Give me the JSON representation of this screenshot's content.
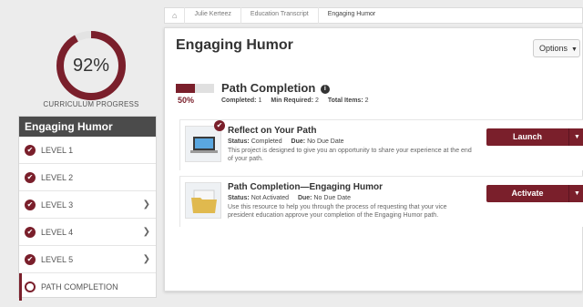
{
  "progress": {
    "percent_label": "92%",
    "percent_value": 92,
    "label": "CURRICULUM PROGRESS"
  },
  "colors": {
    "accent": "#7a1f2b",
    "header_bg": "#4b4b4b"
  },
  "sidebar": {
    "heading": "Engaging Humor",
    "items": [
      {
        "label": "LEVEL 1"
      },
      {
        "label": "LEVEL 2"
      },
      {
        "label": "LEVEL 3"
      },
      {
        "label": "LEVEL 4"
      },
      {
        "label": "LEVEL 5"
      },
      {
        "label": "PATH COMPLETION"
      }
    ]
  },
  "breadcrumb": {
    "home_icon": "home-icon",
    "items": [
      "Julie Kerteez",
      "Education Transcript",
      "Engaging Humor"
    ]
  },
  "main": {
    "title": "Engaging Humor",
    "options_label": "Options",
    "path_completion": {
      "title": "Path Completion",
      "percent_label": "50%",
      "percent_value": 50,
      "completed_label": "Completed:",
      "completed_value": "1",
      "min_required_label": "Min Required:",
      "min_required_value": "2",
      "total_label": "Total Items:",
      "total_value": "2"
    },
    "items": [
      {
        "name": "Reflect on Your Path",
        "status_label": "Status:",
        "status_value": "Completed",
        "due_label": "Due:",
        "due_value": "No Due Date",
        "description": "This project is designed to give you an opportunity to share your experience at the end of your path.",
        "button_label": "Launch",
        "icon": "laptop-icon"
      },
      {
        "name": "Path Completion—Engaging Humor",
        "status_label": "Status:",
        "status_value": "Not Activated",
        "due_label": "Due:",
        "due_value": "No Due Date",
        "description": "Use this resource to help you through the process of requesting that your vice president education approve your completion of the Engaging Humor path.",
        "button_label": "Activate",
        "icon": "folder-icon"
      }
    ]
  }
}
